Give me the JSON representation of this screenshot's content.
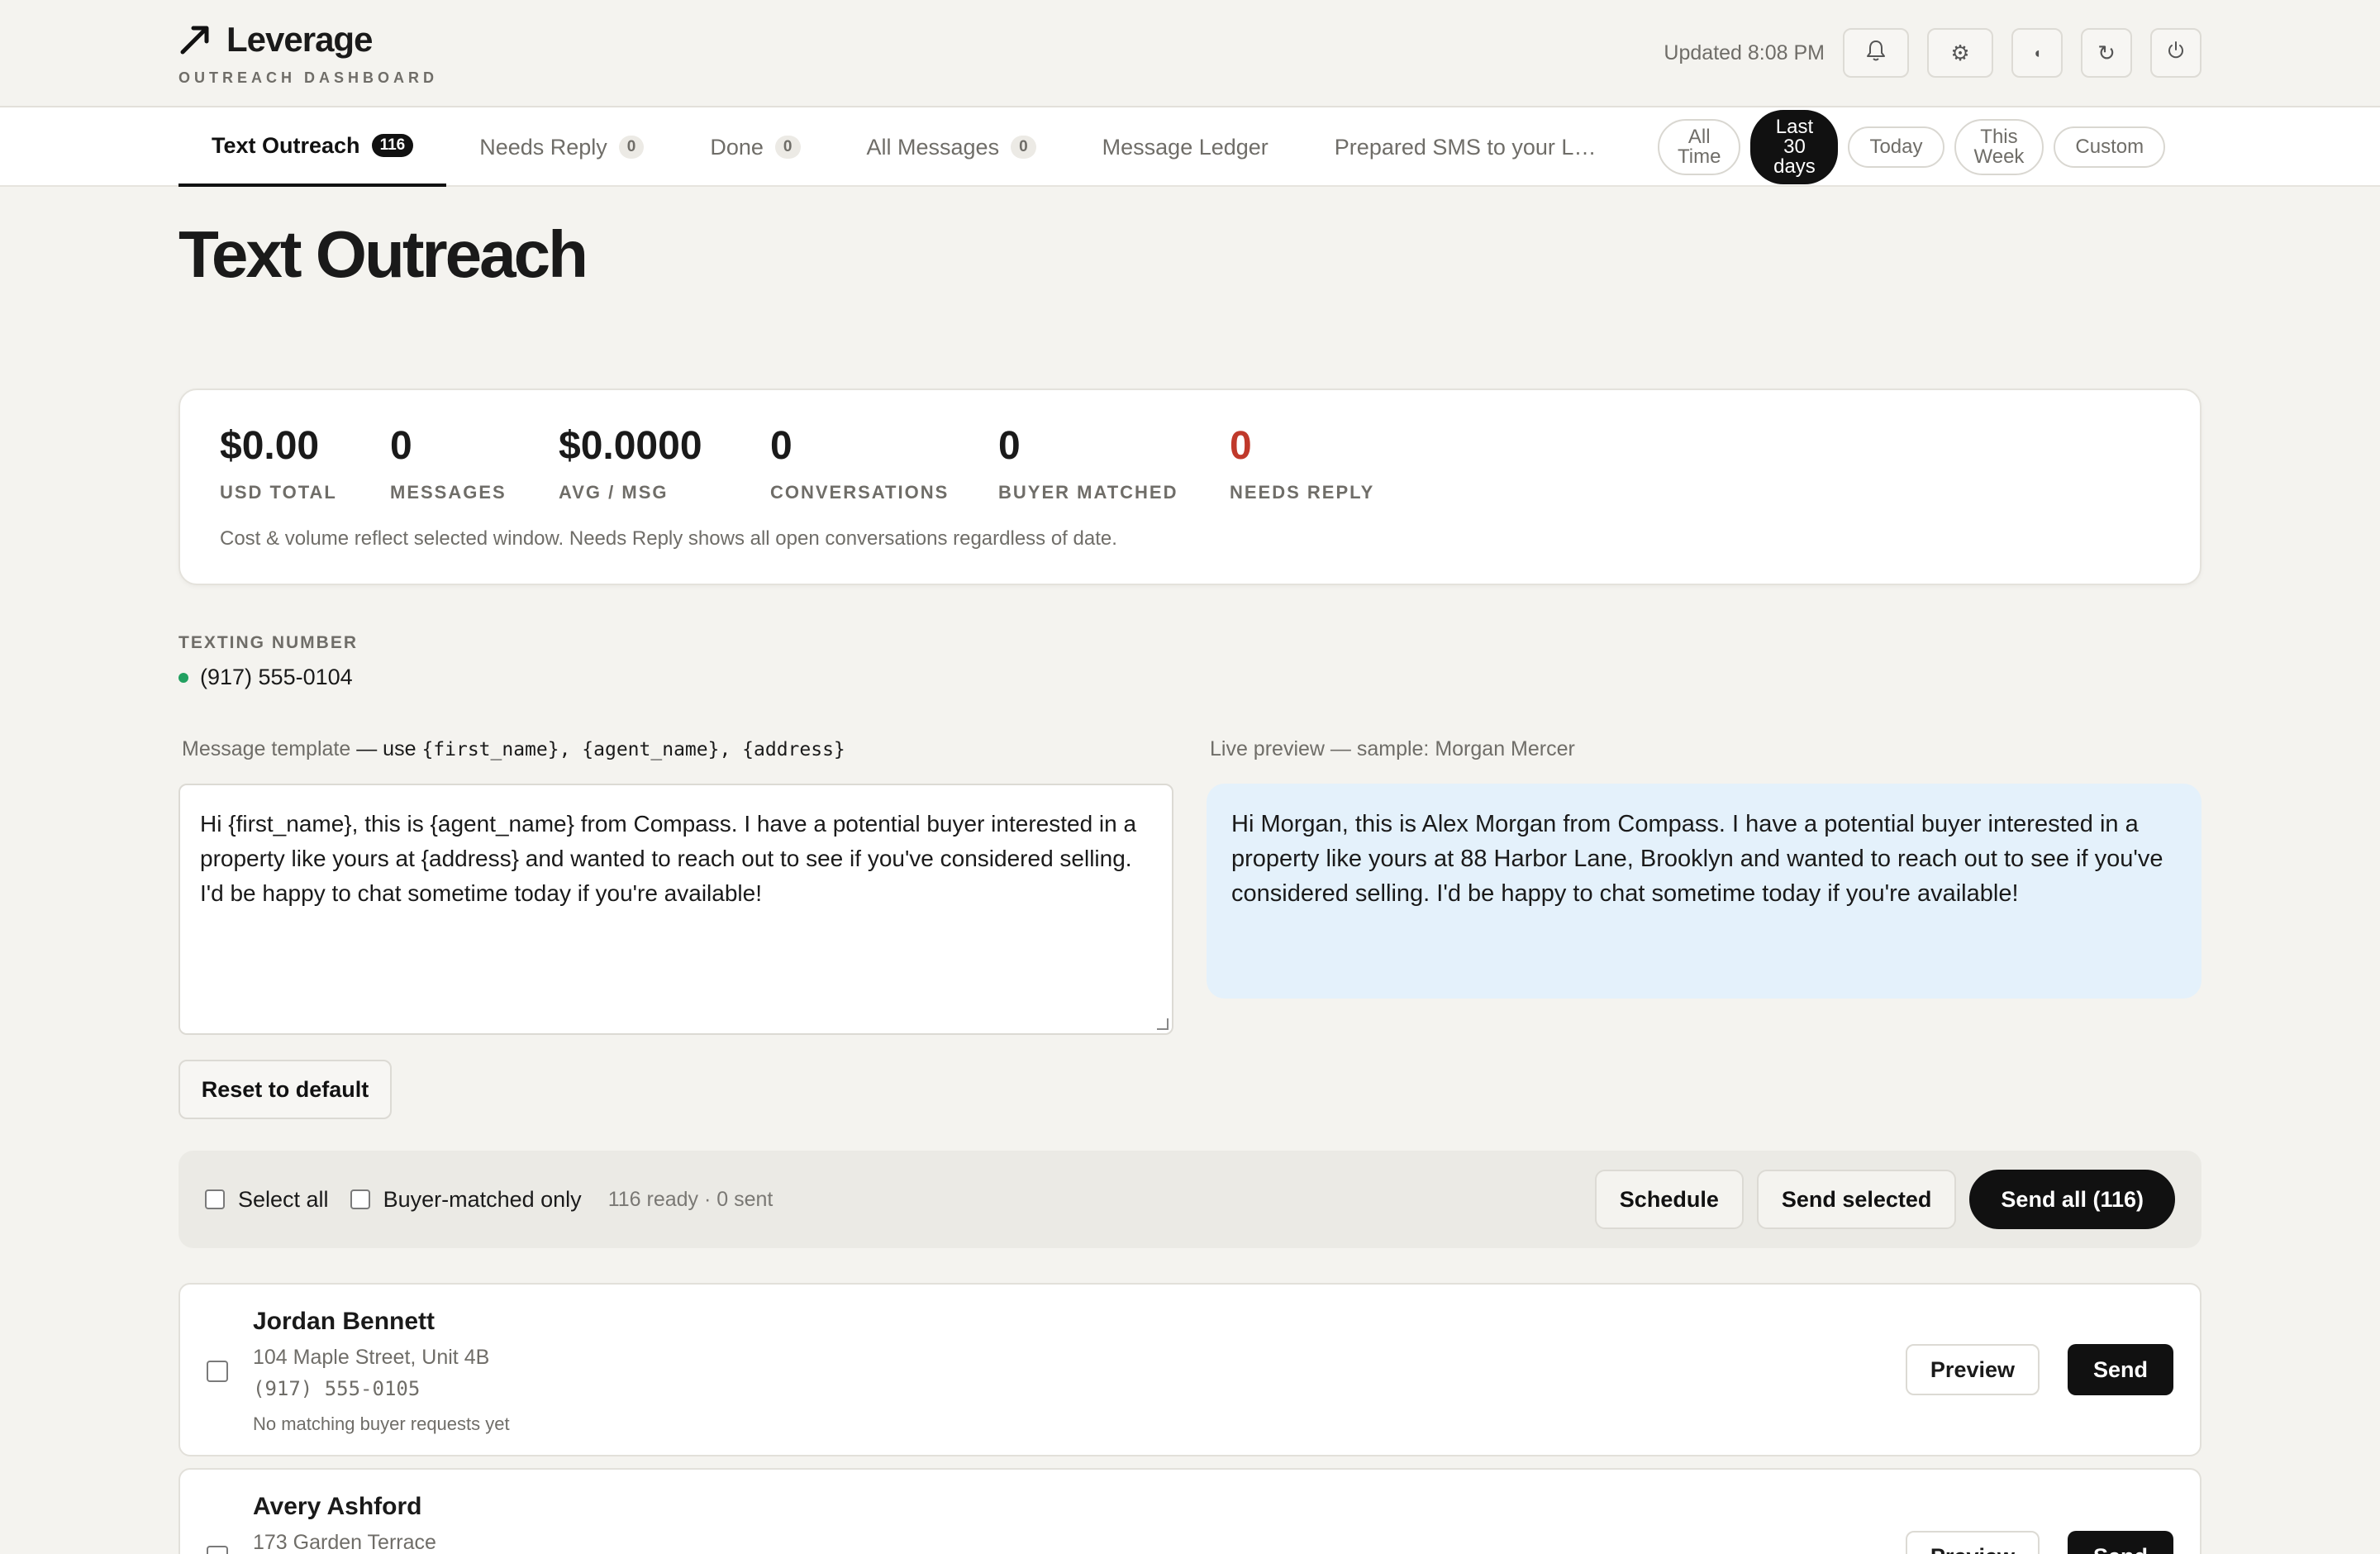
{
  "brand": {
    "name": "Leverage",
    "subtitle": "OUTREACH DASHBOARD"
  },
  "header": {
    "updated": "Updated 8:08 PM",
    "icons": [
      "bell-icon",
      "gear-icon",
      "theme-toggle-icon",
      "refresh-icon",
      "power-icon"
    ],
    "theme_glyph": "◖"
  },
  "tabs": [
    {
      "label": "Text Outreach",
      "count": "116",
      "active": true
    },
    {
      "label": "Needs Reply",
      "count": "0"
    },
    {
      "label": "Done",
      "count": "0"
    },
    {
      "label": "All Messages",
      "count": "0"
    },
    {
      "label": "Message Ledger"
    },
    {
      "label": "Prepared SMS to your Likel..."
    }
  ],
  "filters": [
    {
      "line1": "All",
      "line2": "Time"
    },
    {
      "line1": "Last",
      "line2": "30",
      "line3": "days",
      "active": true
    },
    {
      "label": "Today"
    },
    {
      "line1": "This",
      "line2": "Week"
    },
    {
      "label": "Custom"
    }
  ],
  "page_title": "Text Outreach",
  "stats": {
    "items": [
      {
        "value": "$0.00",
        "label": "USD TOTAL"
      },
      {
        "value": "0",
        "label": "MESSAGES"
      },
      {
        "value": "$0.0000",
        "label": "AVG / MSG"
      },
      {
        "value": "0",
        "label": "CONVERSATIONS"
      },
      {
        "value": "0",
        "label": "BUYER MATCHED"
      },
      {
        "value": "0",
        "label": "NEEDS REPLY"
      }
    ],
    "note": "Cost & volume reflect selected window. Needs Reply shows all open conversations regardless of date.",
    "needs_reply_color": "#c0392b"
  },
  "texting_number": {
    "label": "TEXTING NUMBER",
    "value": "(917) 555-0104",
    "status_color": "#21a060"
  },
  "template": {
    "label": "Message template",
    "hint": " — use ",
    "vars": "{first_name}, {agent_name}, {address}",
    "text": "Hi {first_name}, this is {agent_name} from Compass. I have a potential buyer interested in a property like yours at {address} and wanted to reach out to see if you've considered selling. I'd be happy to chat sometime today if you're available!"
  },
  "preview": {
    "label": "Live preview — sample: Morgan Mercer",
    "text": "Hi Morgan, this is Alex Morgan from Compass. I have a potential buyer interested in a property like yours at 88 Harbor Lane, Brooklyn and wanted to reach out to see if you've considered selling. I'd be happy to chat sometime today if you're available!"
  },
  "reset_label": "Reset to default",
  "action_bar": {
    "select_all": "Select all",
    "buyer_matched": "Buyer-matched only",
    "status": "116 ready · 0 sent",
    "schedule": "Schedule",
    "send_selected": "Send selected",
    "send_all": "Send all (116)"
  },
  "contacts": [
    {
      "name": "Jordan Bennett",
      "address": "104 Maple Street, Unit 4B",
      "phone": "(917) 555-0105",
      "note": "No matching buyer requests yet",
      "preview": "Preview",
      "send": "Send"
    },
    {
      "name": "Avery Ashford",
      "address": "173 Garden Terrace",
      "preview": "Preview",
      "send": "Send"
    }
  ]
}
